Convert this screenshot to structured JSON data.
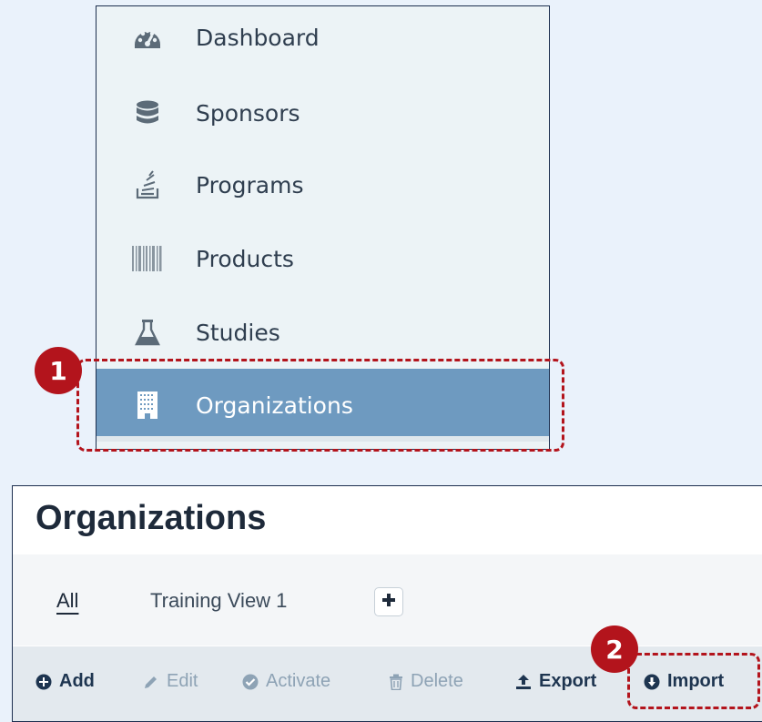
{
  "nav": {
    "items": [
      {
        "label": "Dashboard",
        "icon": "dashboard-gauge-icon"
      },
      {
        "label": "Sponsors",
        "icon": "database-icon"
      },
      {
        "label": "Programs",
        "icon": "stack-tray-icon"
      },
      {
        "label": "Products",
        "icon": "barcode-icon"
      },
      {
        "label": "Studies",
        "icon": "flask-icon"
      },
      {
        "label": "Organizations",
        "icon": "building-icon",
        "active": true
      }
    ]
  },
  "callouts": {
    "step1": "1",
    "step2": "2"
  },
  "page": {
    "title": "Organizations",
    "tabs": [
      {
        "label": "All",
        "active": true
      },
      {
        "label": "Training View 1",
        "active": false
      }
    ],
    "toolbar": {
      "add": "Add",
      "edit": "Edit",
      "activate": "Activate",
      "delete": "Delete",
      "export": "Export",
      "import": "Import"
    }
  },
  "colors": {
    "background": "#eaf2fb",
    "nav_active": "#6e9ac0",
    "callout": "#b3141c",
    "toolbar": "#e3e9ee",
    "text_dark": "#1e2a3a"
  }
}
